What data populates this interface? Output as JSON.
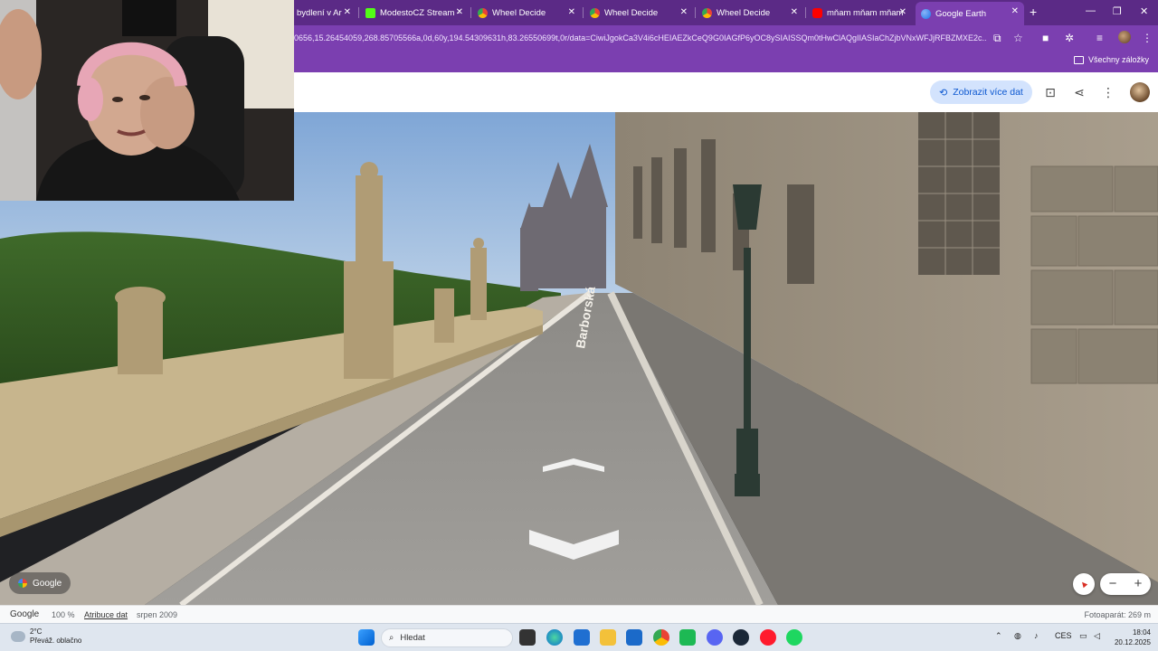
{
  "browser": {
    "tabs": [
      {
        "title": "bydlení v Ar",
        "favicon_color": "#ffffff"
      },
      {
        "title": "ModestoCZ Stream -",
        "favicon_color": "#53fc18"
      },
      {
        "title": "Wheel Decide",
        "favicon_color": "#f4b400"
      },
      {
        "title": "Wheel Decide",
        "favicon_color": "#f4b400"
      },
      {
        "title": "Wheel Decide",
        "favicon_color": "#f4b400"
      },
      {
        "title": "mňam mňam mňam",
        "favicon_color": "#ff0000"
      },
      {
        "title": "Google Earth",
        "favicon_color": "#4285f4"
      }
    ],
    "active_tab_index": 6,
    "new_tab_label": "+",
    "url": "0656,15.26454059,268.85705566a,0d,60y,194.54309631h,83.26550699t,0r/data=CiwiJgokCa3V4i6cHEIAEZkCeQ9G0IAGfP6yOC8ySIAISSQm0tHwClAQgIIASIaChZjbVNxWFJjRFBZMXE2c...",
    "bookmarks_folder": "Všechny záložky",
    "window_controls": {
      "minimize": "—",
      "restore": "❐",
      "close": "✕"
    }
  },
  "google_earth": {
    "more_data_button": "Zobrazit více dat",
    "google_chip": "Google",
    "zoom_in": "+",
    "zoom_out": "−"
  },
  "statusbar": {
    "brand": "Google",
    "zoom": "100 %",
    "attribution": "Atribuce dat",
    "date": "srpen 2009",
    "photographer": "Fotoaparát: 269 m"
  },
  "scene": {
    "street_label": "Barborská"
  },
  "taskbar": {
    "weather_temp": "2°C",
    "weather_desc": "Převáž. oblačno",
    "search_placeholder": "Hledat",
    "language": "CES",
    "time": "18:04",
    "date": "20.12.2025",
    "apps": [
      "start-menu",
      "task-view",
      "edge",
      "store",
      "file-explorer",
      "outlook",
      "chrome",
      "spotify-music-alt",
      "discord",
      "steam",
      "opera-gx",
      "spotify"
    ]
  }
}
